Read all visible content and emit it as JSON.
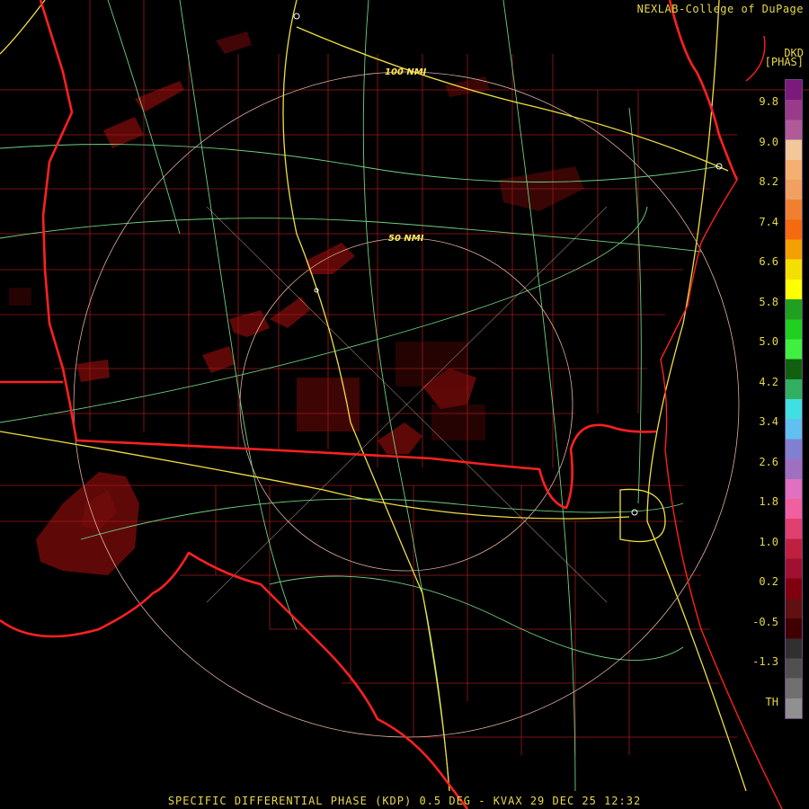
{
  "header": {
    "credit": "NEXLAB-College of DuPage"
  },
  "legend": {
    "product": "DKD",
    "unit": "[PHAS]",
    "ticks": [
      "9.8",
      "9.0",
      "8.2",
      "7.4",
      "6.6",
      "5.8",
      "5.0",
      "4.2",
      "3.4",
      "2.6",
      "1.8",
      "1.0",
      "0.2",
      "-0.5",
      "-1.3",
      "TH"
    ],
    "colors": [
      "#7a1a7a",
      "#9a3a8a",
      "#b05a9a",
      "#f0c89a",
      "#f4b070",
      "#f0a060",
      "#f08030",
      "#f46a10",
      "#f4a000",
      "#f4e000",
      "#ffff00",
      "#20a020",
      "#20d020",
      "#40f040",
      "#106010",
      "#30b060",
      "#40e0e0",
      "#60c0f0",
      "#8080d0",
      "#a070c0",
      "#e070c0",
      "#f060a0",
      "#e04070",
      "#c02040",
      "#a01030",
      "#800010",
      "#601010",
      "#400000",
      "#303030",
      "#505050",
      "#707070",
      "#909090"
    ]
  },
  "rings": [
    {
      "label": "100 NMI"
    },
    {
      "label": "50 NMI"
    }
  ],
  "footer": {
    "caption": "SPECIFIC DIFFERENTIAL PHASE (KDP) 0.5 DEG - KVAX 29 DEC 25 12:32"
  }
}
